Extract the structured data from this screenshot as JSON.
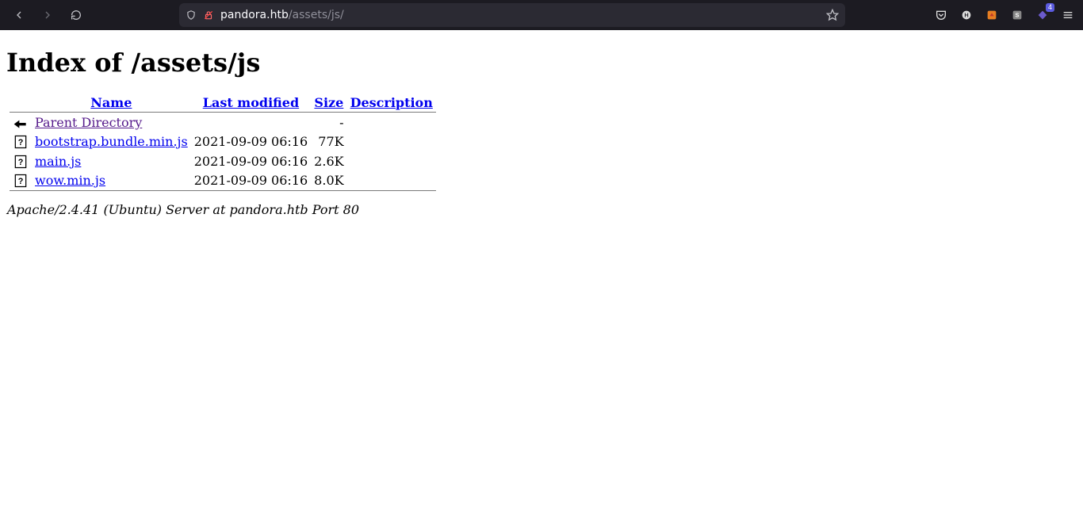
{
  "browser": {
    "url_host": "pandora.htb",
    "url_path": "/assets/js/",
    "badge_count": "4"
  },
  "page": {
    "heading": "Index of /assets/js",
    "columns": {
      "name": "Name",
      "modified": "Last modified",
      "size": "Size",
      "description": "Description"
    },
    "parent": {
      "label": "Parent Directory",
      "size": "-"
    },
    "files": [
      {
        "name": "bootstrap.bundle.min.js",
        "modified": "2021-09-09 06:16",
        "size": "77K"
      },
      {
        "name": "main.js",
        "modified": "2021-09-09 06:16",
        "size": "2.6K"
      },
      {
        "name": "wow.min.js",
        "modified": "2021-09-09 06:16",
        "size": "8.0K"
      }
    ],
    "footer": "Apache/2.4.41 (Ubuntu) Server at pandora.htb Port 80"
  }
}
